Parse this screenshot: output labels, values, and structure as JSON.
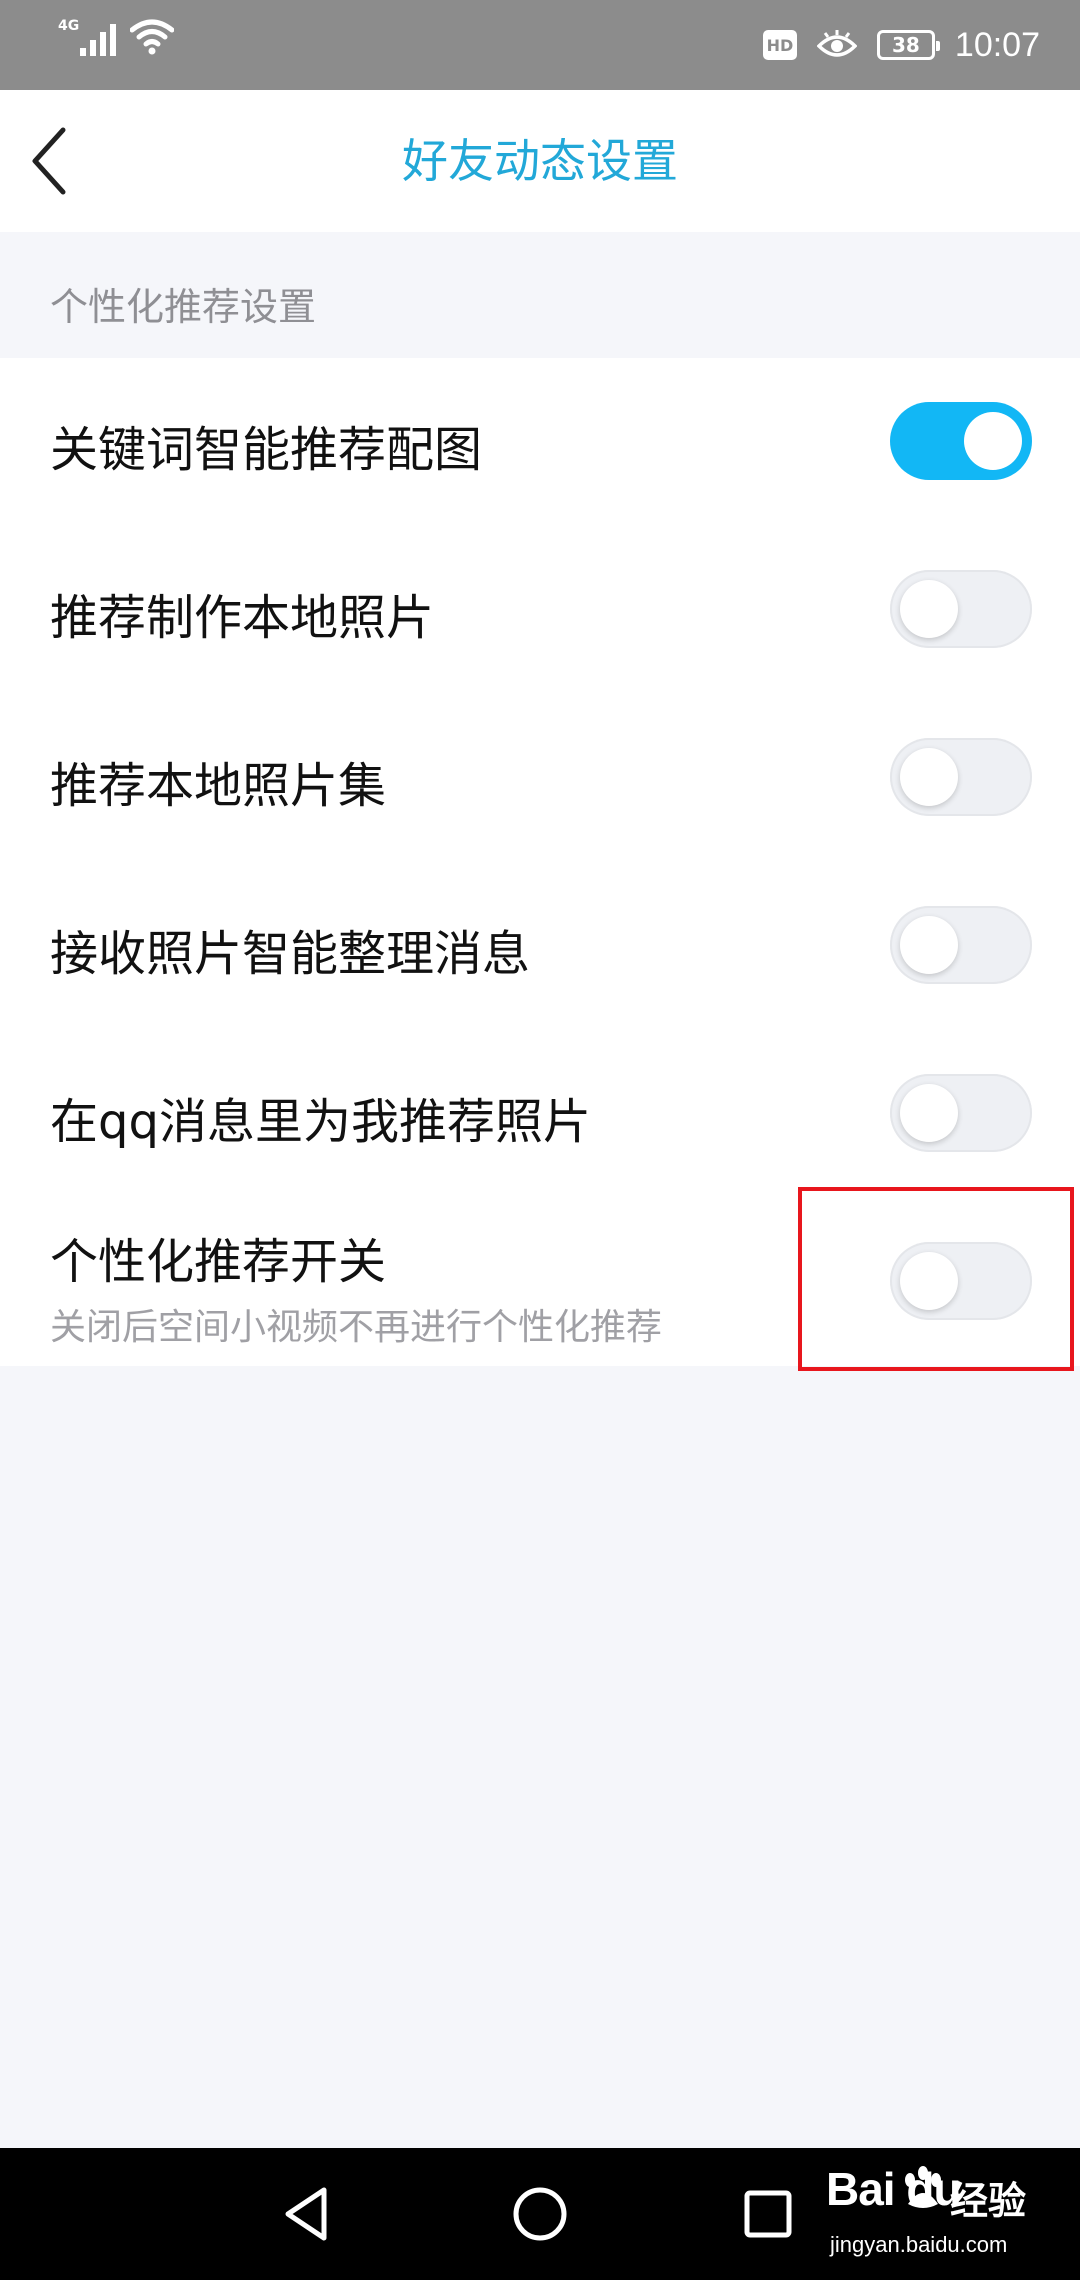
{
  "status_bar": {
    "network": "4G",
    "hd_badge": "HD",
    "battery": "38",
    "time": "10:07",
    "icons": [
      "signal-icon",
      "wifi-icon",
      "hd-icon",
      "eye-comfort-icon",
      "battery-icon"
    ]
  },
  "nav": {
    "title": "好友动态设置",
    "back_icon": "chevron-left-icon"
  },
  "section": {
    "title": "个性化推荐设置"
  },
  "settings": [
    {
      "label": "关键词智能推荐配图",
      "enabled": true
    },
    {
      "label": "推荐制作本地照片",
      "enabled": false
    },
    {
      "label": "推荐本地照片集",
      "enabled": false
    },
    {
      "label": "接收照片智能整理消息",
      "enabled": false
    },
    {
      "label": "在qq消息里为我推荐照片",
      "enabled": false
    },
    {
      "label": "个性化推荐开关",
      "subtitle": "关闭后空间小视频不再进行个性化推荐",
      "enabled": false
    }
  ],
  "colors": {
    "accent": "#12b7f5",
    "title": "#22a8d8",
    "highlight": "#e8161d"
  },
  "system_nav": {
    "icons": [
      "back-triangle-icon",
      "home-circle-icon",
      "recents-square-icon"
    ]
  },
  "watermark": {
    "logo": "Bai du",
    "product": "经验",
    "url": "jingyan.baidu.com"
  }
}
